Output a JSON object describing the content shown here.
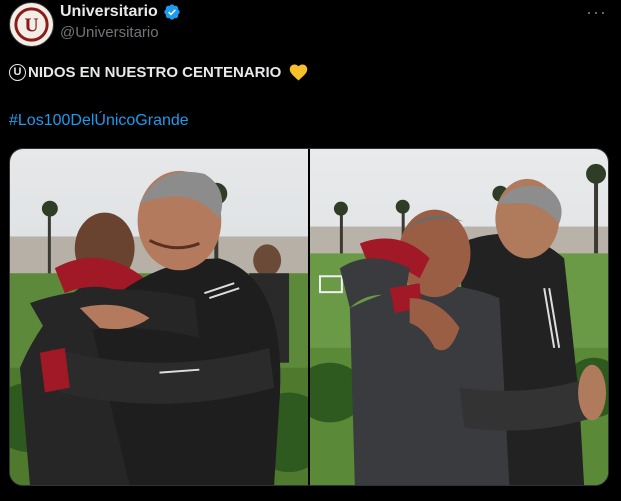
{
  "tweet": {
    "display_name": "Universitario",
    "handle": "@Universitario",
    "verified_icon": "verified-badge-icon",
    "more_icon": "more-options-icon",
    "more_glyph": "···",
    "avatar_letter": "U",
    "text_badge": "U",
    "text": "NIDOS EN NUESTRO CENTENARIO",
    "emoji": "yellow-heart-icon",
    "hashtag": "#Los100DelÚnicoGrande",
    "link_color": "#1d9bf0",
    "brand_color": "#8b1a1a",
    "media": [
      {
        "alt_icon": "photo-icon"
      },
      {
        "alt_icon": "photo-icon"
      }
    ]
  }
}
